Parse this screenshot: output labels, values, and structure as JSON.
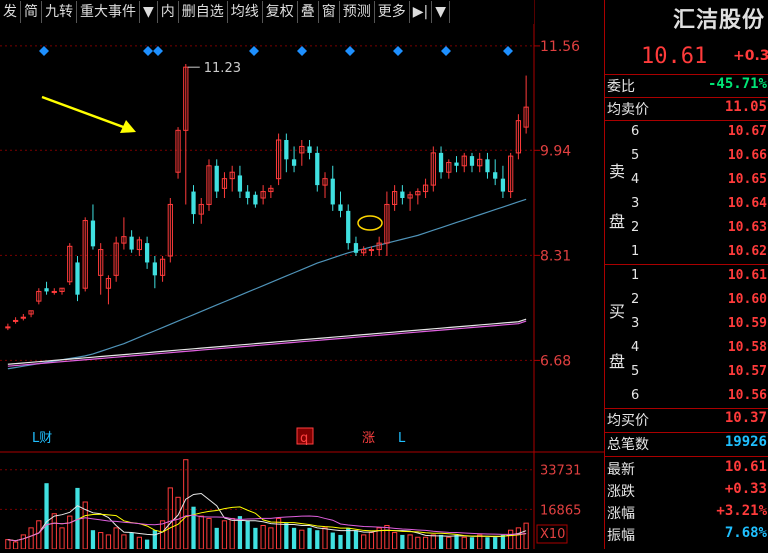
{
  "toolbar": {
    "items": [
      "发",
      "简",
      "九转",
      "重大事件",
      "▼",
      "内",
      "删自选",
      "均线",
      "复权",
      "叠",
      "窗",
      "预测",
      "更多",
      "▶|",
      "▼"
    ]
  },
  "stock": {
    "name": "汇洁股份",
    "price": "10.61",
    "change": "+0.3"
  },
  "quote": {
    "weibi_label": "委比",
    "weibi_value": "-45.71%",
    "avg_sell_label": "均卖价",
    "avg_sell_value": "11.05",
    "sell_label_1": "卖",
    "sell_label_2": "盘",
    "sell_levels": [
      {
        "level": "6",
        "price": "10.67"
      },
      {
        "level": "5",
        "price": "10.66"
      },
      {
        "level": "4",
        "price": "10.65"
      },
      {
        "level": "3",
        "price": "10.64"
      },
      {
        "level": "2",
        "price": "10.63"
      },
      {
        "level": "1",
        "price": "10.62"
      }
    ],
    "buy_label_1": "买",
    "buy_label_2": "盘",
    "buy_levels": [
      {
        "level": "1",
        "price": "10.61"
      },
      {
        "level": "2",
        "price": "10.60"
      },
      {
        "level": "3",
        "price": "10.59"
      },
      {
        "level": "4",
        "price": "10.58"
      },
      {
        "level": "5",
        "price": "10.57"
      },
      {
        "level": "6",
        "price": "10.56"
      }
    ],
    "avg_buy_label": "均买价",
    "avg_buy_value": "10.37",
    "total_trades_label": "总笔数",
    "total_trades_value": "19926",
    "latest_label": "最新",
    "latest_value": "10.61",
    "change_label": "涨跌",
    "change_value": "+0.33",
    "pct_label": "涨幅",
    "pct_value": "+3.21%",
    "amp_label": "振幅",
    "amp_value": "7.68%"
  },
  "chart_data": {
    "type": "candlestick",
    "price_axis_ticks": [
      "11.56",
      "9.94",
      "8.31",
      "6.68"
    ],
    "price_tick_values": [
      11.56,
      9.94,
      8.31,
      6.68
    ],
    "ylim": [
      5.6,
      11.9
    ],
    "max_annotation": "11.23",
    "volume_axis_ticks": [
      "33731",
      "16865"
    ],
    "volume_tick_values": [
      33731,
      16865
    ],
    "volume_unit_label": "X10",
    "volume_max": 40000,
    "event_markers": [
      "L财",
      "q",
      "涨",
      "L"
    ],
    "candles": [
      [
        7.2,
        7.25,
        7.15,
        7.2
      ],
      [
        7.3,
        7.35,
        7.25,
        7.3
      ],
      [
        7.35,
        7.4,
        7.3,
        7.35
      ],
      [
        7.4,
        7.45,
        7.35,
        7.45
      ],
      [
        7.6,
        7.8,
        7.55,
        7.75
      ],
      [
        7.8,
        7.9,
        7.7,
        7.75
      ],
      [
        7.75,
        7.8,
        7.7,
        7.75
      ],
      [
        7.75,
        7.8,
        7.7,
        7.8
      ],
      [
        7.9,
        8.5,
        7.85,
        8.45
      ],
      [
        8.2,
        8.3,
        7.6,
        7.7
      ],
      [
        7.8,
        8.9,
        7.75,
        8.85
      ],
      [
        8.85,
        9.1,
        8.4,
        8.45
      ],
      [
        8.0,
        8.5,
        7.7,
        8.4
      ],
      [
        7.8,
        8.0,
        7.55,
        7.95
      ],
      [
        8.0,
        8.6,
        7.9,
        8.5
      ],
      [
        8.5,
        8.9,
        8.4,
        8.6
      ],
      [
        8.6,
        8.7,
        8.35,
        8.4
      ],
      [
        8.4,
        8.6,
        8.3,
        8.55
      ],
      [
        8.5,
        8.6,
        8.1,
        8.2
      ],
      [
        8.2,
        8.3,
        7.8,
        8.0
      ],
      [
        8.0,
        8.3,
        7.9,
        8.25
      ],
      [
        8.3,
        9.2,
        8.2,
        9.1
      ],
      [
        9.6,
        10.3,
        9.5,
        10.25
      ],
      [
        10.25,
        11.28,
        9.1,
        11.23
      ],
      [
        9.3,
        9.4,
        8.8,
        8.95
      ],
      [
        8.95,
        9.2,
        8.8,
        9.1
      ],
      [
        9.1,
        9.8,
        9.0,
        9.7
      ],
      [
        9.7,
        9.8,
        9.2,
        9.3
      ],
      [
        9.35,
        9.6,
        9.2,
        9.5
      ],
      [
        9.5,
        9.7,
        9.3,
        9.6
      ],
      [
        9.55,
        9.7,
        9.2,
        9.3
      ],
      [
        9.3,
        9.4,
        9.1,
        9.2
      ],
      [
        9.25,
        9.3,
        9.05,
        9.1
      ],
      [
        9.2,
        9.4,
        9.1,
        9.3
      ],
      [
        9.3,
        9.4,
        9.2,
        9.35
      ],
      [
        9.5,
        10.2,
        9.4,
        10.1
      ],
      [
        10.1,
        10.2,
        9.6,
        9.8
      ],
      [
        9.8,
        10.0,
        9.6,
        9.7
      ],
      [
        9.9,
        10.1,
        9.7,
        10.0
      ],
      [
        10.0,
        10.1,
        9.8,
        9.9
      ],
      [
        9.9,
        10.0,
        9.3,
        9.4
      ],
      [
        9.4,
        9.6,
        9.2,
        9.5
      ],
      [
        9.5,
        9.7,
        9.0,
        9.1
      ],
      [
        9.1,
        9.3,
        8.9,
        9.0
      ],
      [
        9.0,
        9.1,
        8.4,
        8.5
      ],
      [
        8.5,
        8.6,
        8.3,
        8.35
      ],
      [
        8.35,
        8.45,
        8.3,
        8.4
      ],
      [
        8.4,
        8.45,
        8.3,
        8.4
      ],
      [
        8.4,
        8.6,
        8.3,
        8.5
      ],
      [
        8.5,
        9.3,
        8.3,
        9.1
      ],
      [
        9.1,
        9.4,
        9.0,
        9.3
      ],
      [
        9.3,
        9.4,
        9.1,
        9.2
      ],
      [
        9.2,
        9.3,
        9.0,
        9.25
      ],
      [
        9.25,
        9.35,
        9.1,
        9.3
      ],
      [
        9.3,
        9.5,
        9.2,
        9.4
      ],
      [
        9.4,
        10.0,
        9.3,
        9.9
      ],
      [
        9.9,
        10.0,
        9.5,
        9.6
      ],
      [
        9.6,
        9.8,
        9.5,
        9.75
      ],
      [
        9.75,
        9.85,
        9.6,
        9.7
      ],
      [
        9.7,
        9.9,
        9.6,
        9.85
      ],
      [
        9.85,
        9.9,
        9.6,
        9.7
      ],
      [
        9.7,
        9.9,
        9.6,
        9.8
      ],
      [
        9.8,
        9.9,
        9.5,
        9.6
      ],
      [
        9.6,
        9.8,
        9.4,
        9.5
      ],
      [
        9.5,
        9.7,
        9.2,
        9.3
      ],
      [
        9.3,
        9.9,
        9.2,
        9.85
      ],
      [
        9.9,
        10.5,
        9.8,
        10.4
      ],
      [
        10.3,
        11.1,
        10.2,
        10.61
      ]
    ],
    "ma_long": [
      6.55,
      6.57,
      6.59,
      6.61,
      6.63,
      6.65,
      6.67,
      6.69,
      6.71,
      6.73,
      6.75,
      6.78,
      6.82,
      6.86,
      6.9,
      6.94,
      6.99,
      7.04,
      7.09,
      7.14,
      7.19,
      7.24,
      7.29,
      7.34,
      7.39,
      7.44,
      7.49,
      7.54,
      7.59,
      7.64,
      7.69,
      7.74,
      7.79,
      7.84,
      7.89,
      7.94,
      7.99,
      8.04,
      8.09,
      8.14,
      8.19,
      8.23,
      8.27,
      8.31,
      8.35,
      8.38,
      8.41,
      8.44,
      8.47,
      8.5,
      8.53,
      8.56,
      8.59,
      8.62,
      8.66,
      8.7,
      8.74,
      8.78,
      8.82,
      8.86,
      8.9,
      8.94,
      8.98,
      9.02,
      9.06,
      9.1,
      9.14,
      9.18
    ],
    "ma_120": [
      6.62,
      6.63,
      6.64,
      6.65,
      6.66,
      6.67,
      6.68,
      6.69,
      6.7,
      6.71,
      6.72,
      6.73,
      6.74,
      6.75,
      6.76,
      6.77,
      6.78,
      6.79,
      6.8,
      6.81,
      6.82,
      6.83,
      6.84,
      6.85,
      6.86,
      6.87,
      6.88,
      6.89,
      6.9,
      6.91,
      6.92,
      6.93,
      6.94,
      6.95,
      6.96,
      6.97,
      6.98,
      6.99,
      7.0,
      7.01,
      7.02,
      7.03,
      7.04,
      7.05,
      7.06,
      7.07,
      7.08,
      7.09,
      7.1,
      7.11,
      7.12,
      7.13,
      7.14,
      7.15,
      7.16,
      7.17,
      7.18,
      7.19,
      7.2,
      7.21,
      7.22,
      7.23,
      7.24,
      7.25,
      7.26,
      7.27,
      7.28,
      7.32
    ],
    "volumes": [
      4000,
      3000,
      6000,
      9000,
      12000,
      28000,
      15000,
      9000,
      14000,
      26000,
      20000,
      8000,
      7000,
      6000,
      9000,
      6000,
      7000,
      5000,
      4000,
      8000,
      12000,
      26000,
      22000,
      38000,
      18000,
      14000,
      13000,
      9000,
      12000,
      13000,
      14000,
      12000,
      9000,
      10000,
      9000,
      13000,
      11000,
      9000,
      8000,
      9000,
      8000,
      9000,
      7000,
      6000,
      9000,
      8000,
      6000,
      7000,
      9000,
      10000,
      7000,
      6000,
      6000,
      5000,
      5000,
      6000,
      6000,
      5000,
      6000,
      5000,
      5000,
      6000,
      5000,
      5000,
      6000,
      8000,
      9000,
      11000
    ]
  }
}
